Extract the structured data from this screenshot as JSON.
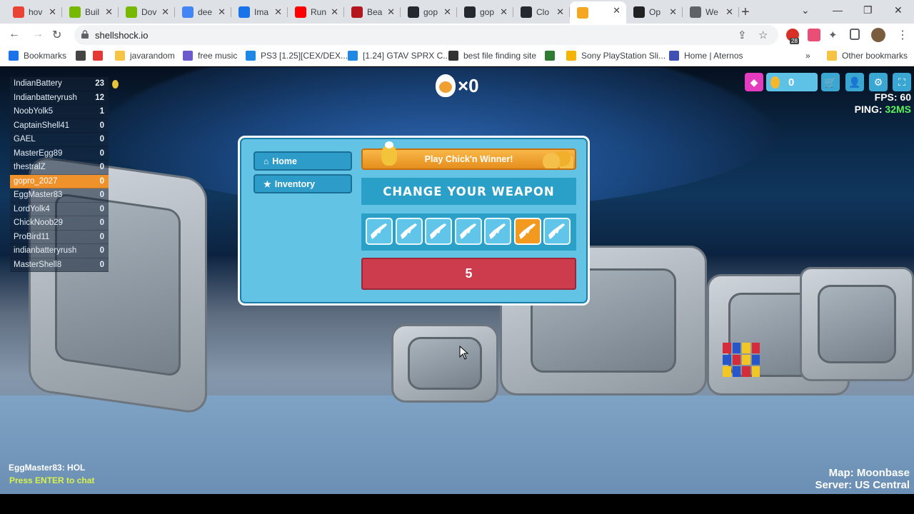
{
  "browser": {
    "tabs": [
      {
        "label": "hov",
        "icon": "google-icon",
        "color": "#ea4335"
      },
      {
        "label": "Buil",
        "icon": "nvidia-icon",
        "color": "#76b900"
      },
      {
        "label": "Dov",
        "icon": "nvidia-icon",
        "color": "#76b900"
      },
      {
        "label": "dee",
        "icon": "google-icon",
        "color": "#4285f4"
      },
      {
        "label": "Ima",
        "icon": "trend-icon",
        "color": "#1a73e8"
      },
      {
        "label": "Run",
        "icon": "youtube-icon",
        "color": "#ff0000"
      },
      {
        "label": "Bea",
        "icon": "m-icon",
        "color": "#b3161f"
      },
      {
        "label": "gop",
        "icon": "github-icon",
        "color": "#24292f"
      },
      {
        "label": "gop",
        "icon": "github-icon",
        "color": "#24292f"
      },
      {
        "label": "Clo",
        "icon": "github-icon",
        "color": "#24292f"
      },
      {
        "label": "",
        "icon": "shellshock-icon",
        "color": "#f5a623",
        "active": true
      },
      {
        "label": "Op",
        "icon": "openai-icon",
        "color": "#222222"
      },
      {
        "label": "We",
        "icon": "globe-icon",
        "color": "#5f6368"
      }
    ],
    "url": "shellshock.io",
    "extension_badge": "28",
    "bookmarks": [
      {
        "label": "Bookmarks",
        "color": "#1a73e8"
      },
      {
        "label": "",
        "color": "#444444"
      },
      {
        "label": "",
        "color": "#e53935"
      },
      {
        "label": "javarandom",
        "color": "#f6c343"
      },
      {
        "label": "free music",
        "color": "#6a5acd"
      },
      {
        "label": "PS3 [1.25][CEX/DEX...",
        "color": "#1e88e5"
      },
      {
        "label": "[1.24] GTAV SPRX C...",
        "color": "#1e88e5"
      },
      {
        "label": "best file finding site",
        "color": "#333333"
      },
      {
        "label": "",
        "color": "#2e7d32"
      },
      {
        "label": "Sony PlayStation Sli...",
        "color": "#f4b400"
      },
      {
        "label": "Home | Aternos",
        "color": "#3f51b5"
      }
    ],
    "other_bookmarks": "Other bookmarks"
  },
  "scoreboard": [
    {
      "name": "IndianBattery",
      "score": "23"
    },
    {
      "name": "Indianbatteryrush",
      "score": "12"
    },
    {
      "name": "NoobYolk5",
      "score": "1"
    },
    {
      "name": "CaptainShell41",
      "score": "0"
    },
    {
      "name": "GAEL",
      "score": "0"
    },
    {
      "name": "MasterEgg89",
      "score": "0"
    },
    {
      "name": "thestralZ",
      "score": "0"
    },
    {
      "name": "gopro_2027",
      "score": "0",
      "me": true
    },
    {
      "name": "EggMaster83",
      "score": "0"
    },
    {
      "name": "LordYolk4",
      "score": "0"
    },
    {
      "name": "ChickNoob29",
      "score": "0"
    },
    {
      "name": "ProBird11",
      "score": "0"
    },
    {
      "name": "indianbatteryrush",
      "score": "0"
    },
    {
      "name": "MasterShell8",
      "score": "0"
    }
  ],
  "hud": {
    "kills": "×0",
    "eggs": "0",
    "fps_label": "FPS: 60",
    "ping_label": "PING:",
    "ping_value": "32MS"
  },
  "menu": {
    "home": "Home",
    "inventory": "Inventory",
    "chickn_winner": "Play Chick'n Winner!",
    "change_weapon": "CHANGE YOUR WEAPON",
    "selected_weapon_index": 5,
    "weapons": [
      "eggk47",
      "scrambler",
      "free-ranger",
      "rpegg",
      "whipper",
      "crackshot",
      "tri-hard"
    ],
    "countdown": "5"
  },
  "chat": {
    "last_message": "EggMaster83: HOL",
    "hint": "Press ENTER to chat"
  },
  "map": {
    "map_label": "Map: Moonbase",
    "server_label": "Server: US Central"
  }
}
